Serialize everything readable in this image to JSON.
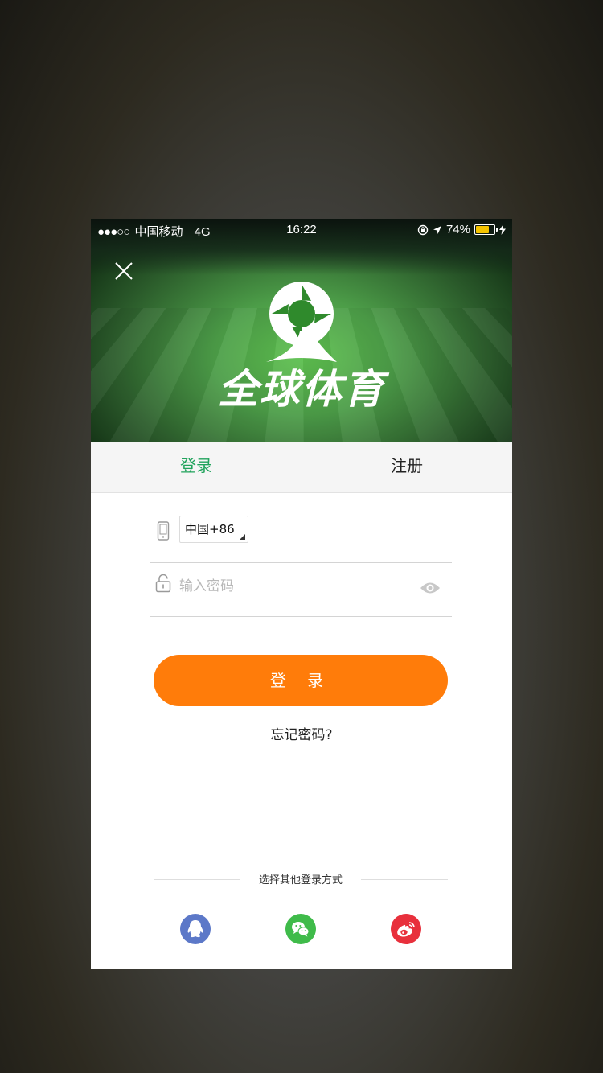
{
  "status_bar": {
    "signal_dots": "●●●○○",
    "carrier": "中国移动",
    "network": "4G",
    "time": "16:22",
    "battery_percent": "74%",
    "battery_level": 0.74,
    "battery_color": "#f5c400"
  },
  "hero": {
    "brand_name": "全球体育",
    "close_icon": "close-icon",
    "logo_icon": "brand-logo-icon"
  },
  "tabs": [
    {
      "label": "登录",
      "active": true
    },
    {
      "label": "注册",
      "active": false
    }
  ],
  "form": {
    "country_code": "中国+86",
    "phone_icon": "phone-icon",
    "password_placeholder": "输入密码",
    "lock_icon": "lock-icon",
    "eye_icon": "eye-icon"
  },
  "login_button": "登 录",
  "forgot_password": "忘记密码?",
  "other_login": {
    "title": "选择其他登录方式",
    "providers": [
      {
        "icon": "qq-icon",
        "color": "#5c78c8"
      },
      {
        "icon": "wechat-icon",
        "color": "#3fbb4a"
      },
      {
        "icon": "weibo-icon",
        "color": "#e8303c"
      }
    ]
  },
  "colors": {
    "accent_green": "#21a35c",
    "login_orange": "#ff7c0a"
  }
}
